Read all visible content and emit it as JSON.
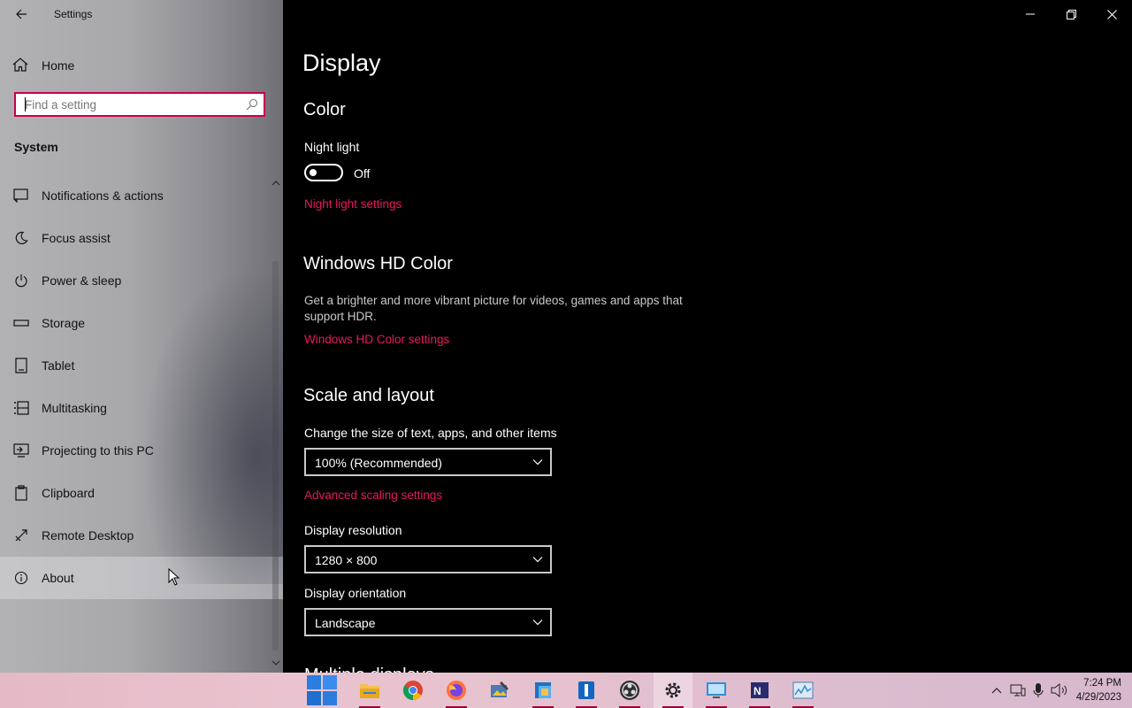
{
  "app": {
    "title": "Settings"
  },
  "sidebar": {
    "home_label": "Home",
    "search_placeholder": "Find a setting",
    "section_label": "System",
    "items": [
      {
        "label": "Notifications & actions",
        "icon": "notifications-icon"
      },
      {
        "label": "Focus assist",
        "icon": "moon-icon"
      },
      {
        "label": "Power & sleep",
        "icon": "power-icon"
      },
      {
        "label": "Storage",
        "icon": "storage-icon"
      },
      {
        "label": "Tablet",
        "icon": "tablet-icon"
      },
      {
        "label": "Multitasking",
        "icon": "multitasking-icon"
      },
      {
        "label": "Projecting to this PC",
        "icon": "projecting-icon"
      },
      {
        "label": "Clipboard",
        "icon": "clipboard-icon"
      },
      {
        "label": "Remote Desktop",
        "icon": "remote-desktop-icon"
      },
      {
        "label": "About",
        "icon": "info-icon",
        "selected": true
      }
    ]
  },
  "main": {
    "page_title": "Display",
    "color": {
      "heading": "Color",
      "night_light_label": "Night light",
      "night_light_state": "Off",
      "night_light_on": false,
      "night_light_link": "Night light settings"
    },
    "hdr": {
      "heading": "Windows HD Color",
      "description": "Get a brighter and more vibrant picture for videos, games and apps that support HDR.",
      "link": "Windows HD Color settings"
    },
    "scale": {
      "heading": "Scale and layout",
      "size_label": "Change the size of text, apps, and other items",
      "size_value": "100% (Recommended)",
      "advanced_link": "Advanced scaling settings",
      "resolution_label": "Display resolution",
      "resolution_value": "1280 × 800",
      "orientation_label": "Display orientation",
      "orientation_value": "Landscape"
    },
    "next_heading": "Multiple displays"
  },
  "taskbar": {
    "apps": [
      {
        "name": "start-button"
      },
      {
        "name": "file-explorer-icon"
      },
      {
        "name": "chrome-icon"
      },
      {
        "name": "firefox-icon"
      },
      {
        "name": "photo-editor-icon"
      },
      {
        "name": "virtualbox-icon"
      },
      {
        "name": "app-i-icon"
      },
      {
        "name": "obs-icon"
      },
      {
        "name": "settings-icon",
        "active": true
      },
      {
        "name": "remote-app-icon"
      },
      {
        "name": "onenote-icon"
      },
      {
        "name": "task-manager-icon"
      }
    ],
    "time": "7:24 PM",
    "date": "4/29/2023"
  },
  "colors": {
    "accent": "#e8185f",
    "search_border": "#c6004f"
  }
}
